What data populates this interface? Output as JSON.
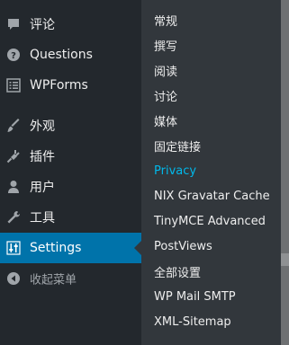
{
  "colors": {
    "sidebar_bg": "#23282d",
    "submenu_bg": "#32373c",
    "active_bg": "#0073aa",
    "current_submenu_text": "#00b9eb",
    "text": "#eeeeee",
    "icon": "#a0a5aa"
  },
  "sidebar": {
    "items": [
      {
        "label": "评论",
        "icon": "comment-icon"
      },
      {
        "label": "Questions",
        "icon": "question-circle-icon"
      },
      {
        "label": "WPForms",
        "icon": "forms-icon"
      },
      {
        "label": "外观",
        "icon": "paintbrush-icon"
      },
      {
        "label": "插件",
        "icon": "plugin-icon"
      },
      {
        "label": "用户",
        "icon": "user-icon"
      },
      {
        "label": "工具",
        "icon": "wrench-icon"
      },
      {
        "label": "Settings",
        "icon": "settings-sliders-icon",
        "active": true
      },
      {
        "label": "收起菜单",
        "icon": "collapse-arrow-icon"
      }
    ]
  },
  "submenu": {
    "items": [
      {
        "label": "常规"
      },
      {
        "label": "撰写"
      },
      {
        "label": "阅读"
      },
      {
        "label": "讨论"
      },
      {
        "label": "媒体"
      },
      {
        "label": "固定链接"
      },
      {
        "label": "Privacy",
        "current": true
      },
      {
        "label": "NIX Gravatar Cache"
      },
      {
        "label": "TinyMCE Advanced"
      },
      {
        "label": "PostViews"
      },
      {
        "label": "全部设置"
      },
      {
        "label": "WP Mail SMTP"
      },
      {
        "label": "XML-Sitemap"
      }
    ]
  }
}
